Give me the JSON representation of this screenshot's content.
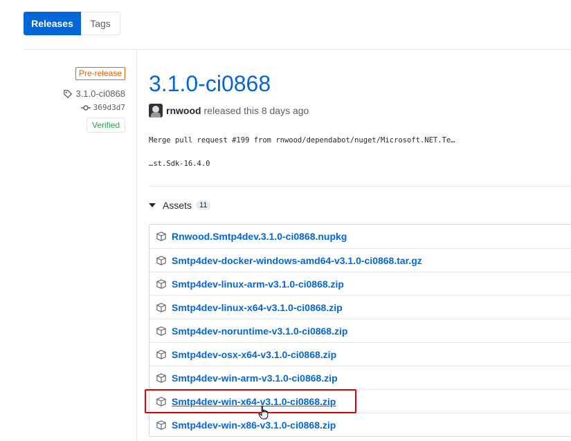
{
  "tabs": [
    {
      "label": "Releases",
      "active": true
    },
    {
      "label": "Tags",
      "active": false
    }
  ],
  "sidebar": {
    "prerelease_label": "Pre-release",
    "tag": "3.1.0-ci0868",
    "commit": "369d3d7",
    "verified_label": "Verified",
    "icons": [
      "tag-icon",
      "commit-icon"
    ]
  },
  "release": {
    "title": "3.1.0-ci0868",
    "author": "rnwood",
    "released_text": "released this 8 days ago",
    "body_line1": "Merge pull request #199 from rnwood/dependabot/nuget/Microsoft.NET.Te…",
    "body_line2": "…st.Sdk-16.4.0"
  },
  "assets": {
    "heading": "Assets",
    "count": "11",
    "items": [
      "Rnwood.Smtp4dev.3.1.0-ci0868.nupkg",
      "Smtp4dev-docker-windows-amd64-v3.1.0-ci0868.tar.gz",
      "Smtp4dev-linux-arm-v3.1.0-ci0868.zip",
      "Smtp4dev-linux-x64-v3.1.0-ci0868.zip",
      "Smtp4dev-noruntime-v3.1.0-ci0868.zip",
      "Smtp4dev-osx-x64-v3.1.0-ci0868.zip",
      "Smtp4dev-win-arm-v3.1.0-ci0868.zip",
      "Smtp4dev-win-x64-v3.1.0-ci0868.zip",
      "Smtp4dev-win-x86-v3.1.0-ci0868.zip"
    ],
    "hovered_item": "Smtp4dev-win-x64-v3.1.0-ci0868.zip"
  },
  "colors": {
    "accent": "#0366d6",
    "prerelease": "#e36209",
    "verified": "#28a745",
    "highlight": "#e00000"
  }
}
